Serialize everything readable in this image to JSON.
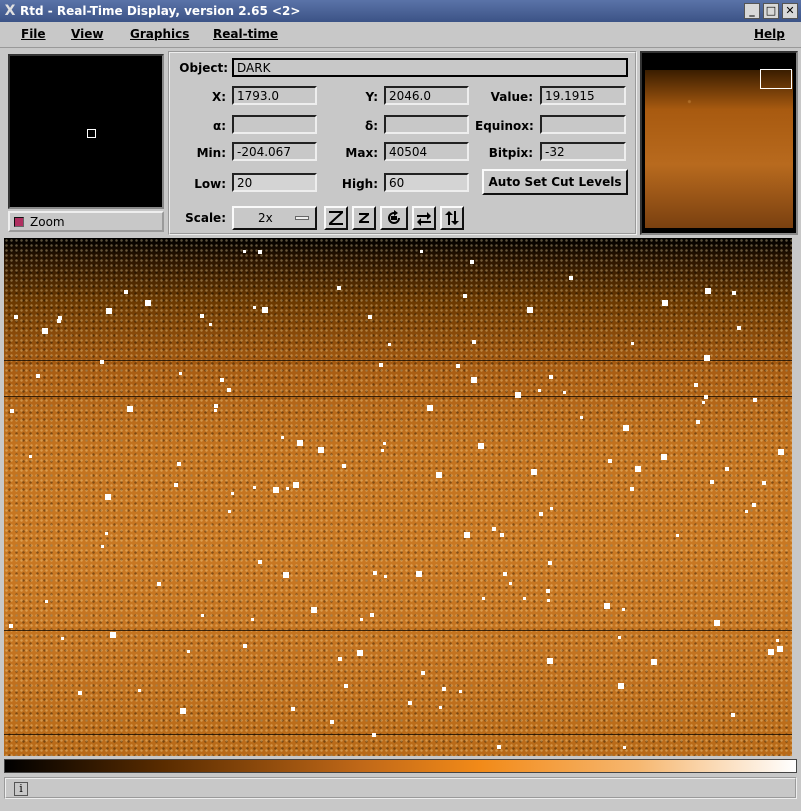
{
  "window": {
    "app_icon": "X",
    "title": "Rtd - Real-Time Display, version 2.65 <2>",
    "controls": [
      "_",
      "□",
      "✕"
    ]
  },
  "menu": {
    "items": [
      "File",
      "View",
      "Graphics",
      "Real-time"
    ],
    "help": "Help"
  },
  "zoom": {
    "toggle_label": "Zoom"
  },
  "info": {
    "object_label": "Object:",
    "object_value": "DARK",
    "x_label": "X:",
    "x_value": "1793.0",
    "y_label": "Y:",
    "y_value": "2046.0",
    "value_label": "Value:",
    "value_value": "19.1915",
    "alpha_label": "α:",
    "alpha_value": "",
    "delta_label": "δ:",
    "delta_value": "",
    "equinox_label": "Equinox:",
    "equinox_value": "",
    "min_label": "Min:",
    "min_value": "-204.067",
    "max_label": "Max:",
    "max_value": "40504",
    "bitpix_label": "Bitpix:",
    "bitpix_value": "-32",
    "low_label": "Low:",
    "low_value": "20",
    "high_label": "High:",
    "high_value": "60",
    "auto_cut_label": "Auto Set Cut Levels",
    "scale_label": "Scale:",
    "scale_value": "2x"
  },
  "toolbar_icons": [
    "zoom-in-icon",
    "zoom-out-icon",
    "rotate-icon",
    "flip-x-icon",
    "flip-y-icon"
  ],
  "colors": {
    "titlebar": "#3c5386",
    "panel": "#c8c8c8",
    "image_accent": "#c97822"
  },
  "status": {
    "icon": "i",
    "text": ""
  }
}
